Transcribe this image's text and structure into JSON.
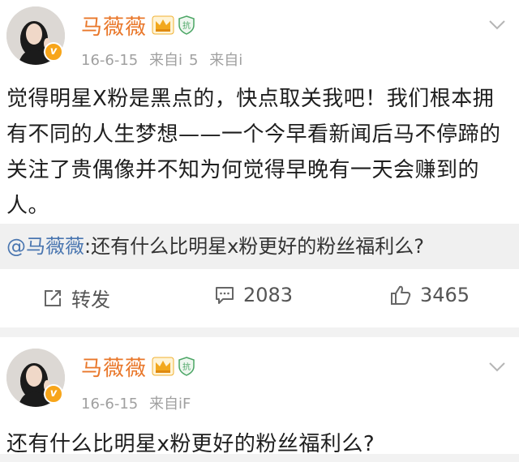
{
  "post1": {
    "username": "马薇薇",
    "date": "16-6-15",
    "source1": "来自i",
    "source1_suffix": "5",
    "source2": "来自i",
    "verified_badge": "v",
    "shield_badge": "抗",
    "text": "觉得明星X粉是黑点的，快点取关我吧！我们根本拥有不同的人生梦想——一个今早看新闻后马不停蹄的关注了贵偶像并不知为何觉得早晚有一天会赚到的人。",
    "quote_mention": "@马薇薇",
    "quote_text": ":还有什么比明星x粉更好的粉丝福利么?",
    "repost_label": "转发",
    "comment_count": "2083",
    "like_count": "3465"
  },
  "post2": {
    "username": "马薇薇",
    "date": "16-6-15",
    "source": "来自iF",
    "verified_badge": "v",
    "shield_badge": "抗",
    "text": "还有什么比明星x粉更好的粉丝福利么?"
  },
  "colors": {
    "username": "#e9772a",
    "meta": "#a0a0a0",
    "mention": "#4a76b0",
    "verified_badge": "#f7a51a",
    "quote_bg": "#f0f0f0",
    "separator": "#f2f2f2"
  },
  "icons": {
    "avatar": "user-avatar",
    "verified": "verified-v-icon",
    "crown": "crown-icon",
    "shield": "shield-icon",
    "chevron": "chevron-down-icon",
    "repost": "repost-icon",
    "comment": "comment-icon",
    "like": "thumbs-up-icon"
  }
}
